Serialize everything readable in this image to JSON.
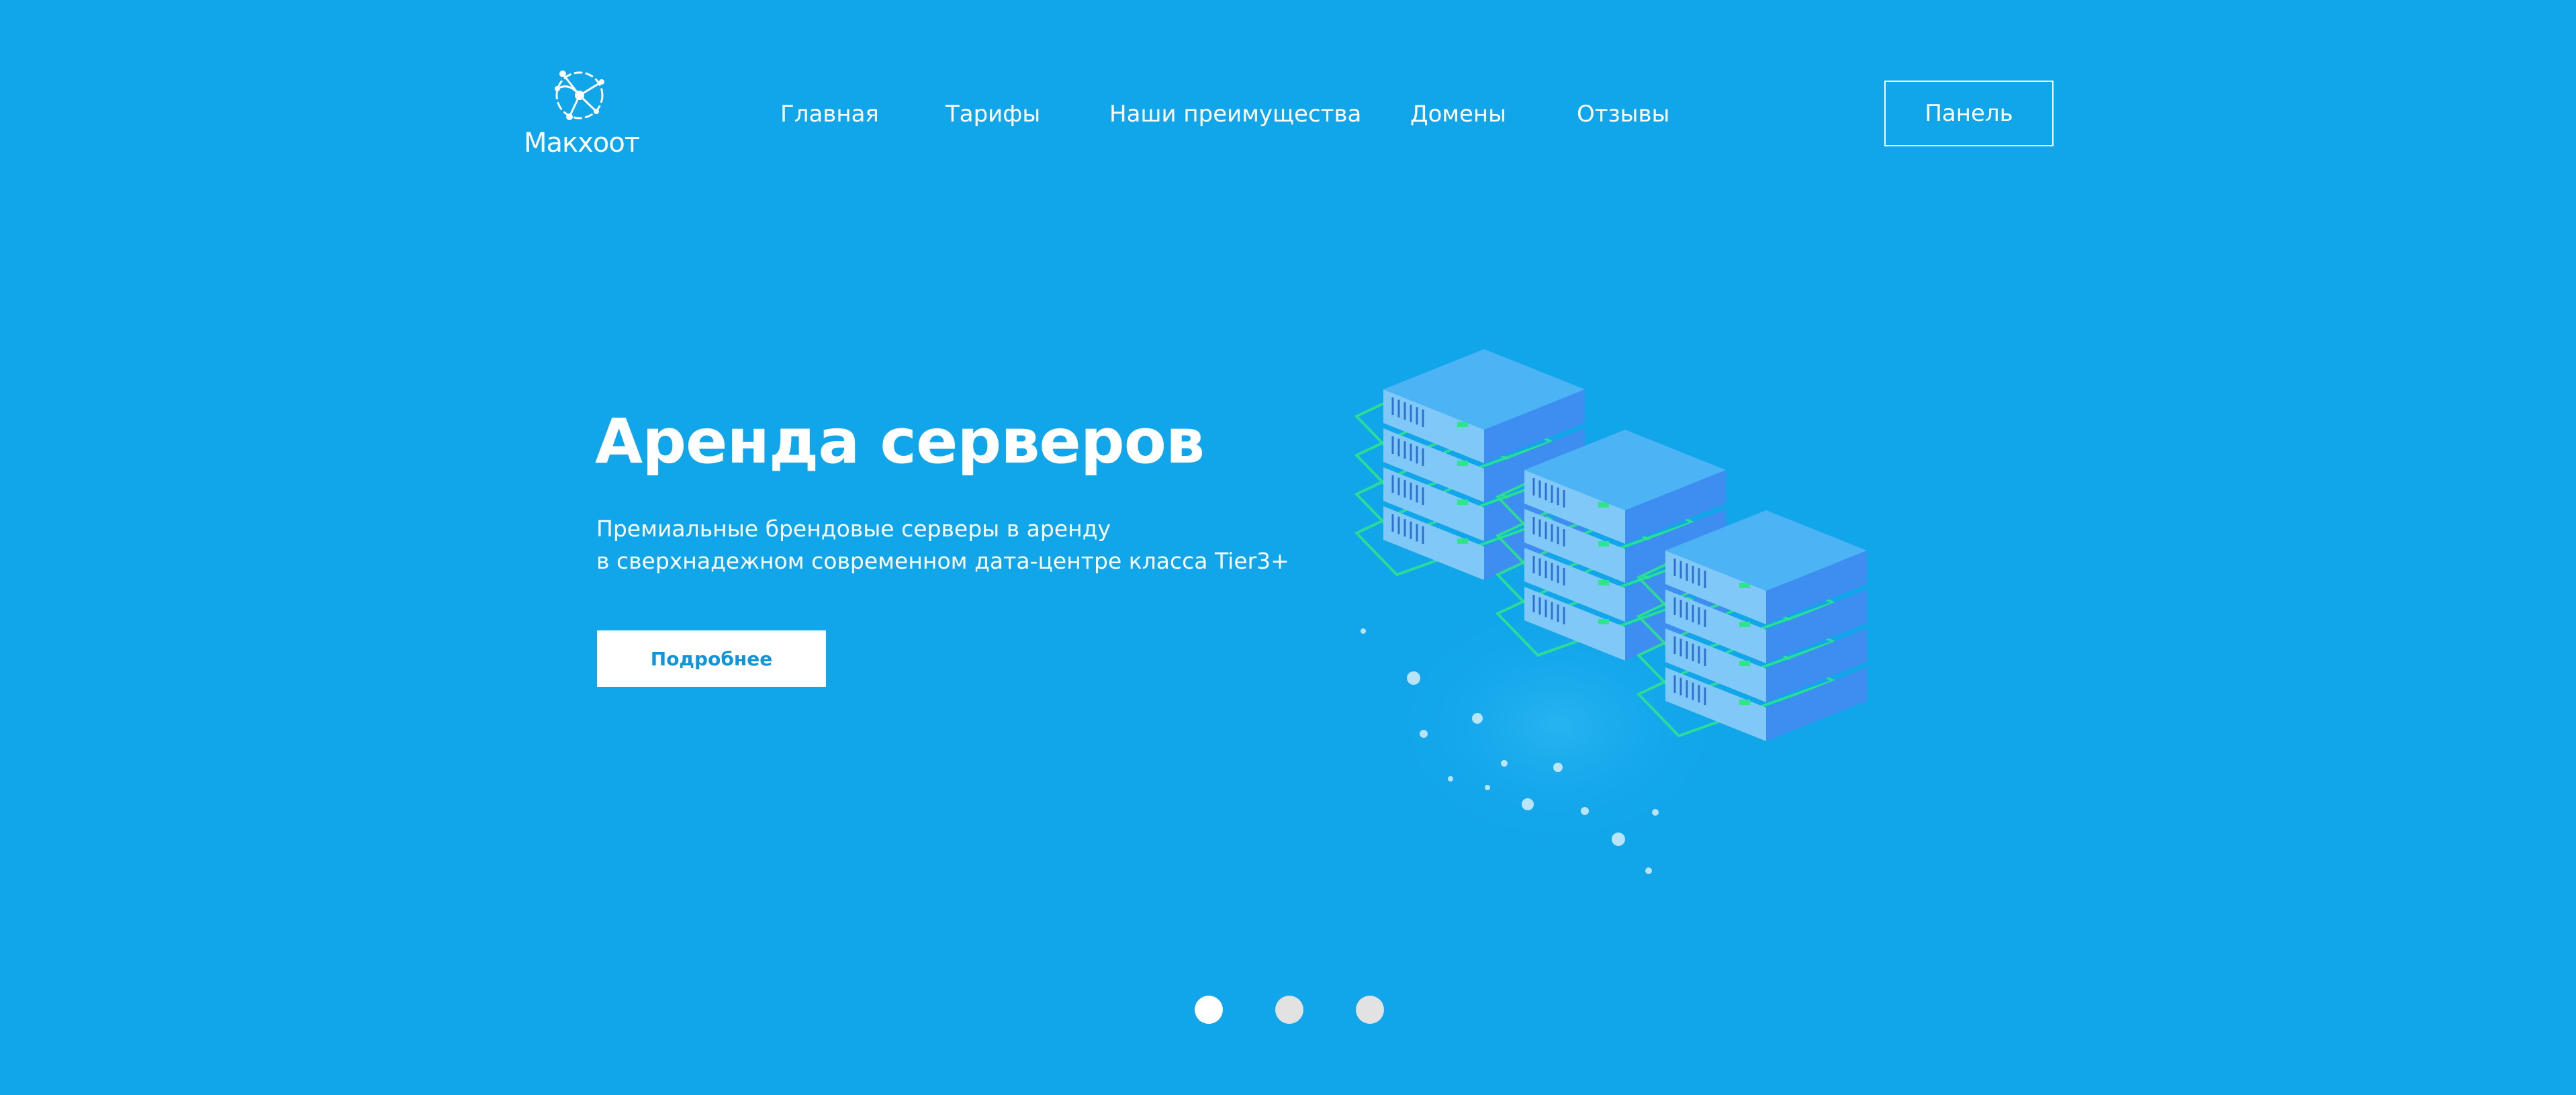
{
  "brand": {
    "name": "Макхоот"
  },
  "nav": {
    "items": [
      {
        "label": "Главная"
      },
      {
        "label": "Тарифы"
      },
      {
        "label": "Наши преимущества"
      },
      {
        "label": "Домены"
      },
      {
        "label": "Отзывы"
      }
    ],
    "panel_label": "Панель"
  },
  "hero": {
    "title": "Аренда серверов",
    "subtitle_line1": "Премиальные брендовые серверы в аренду",
    "subtitle_line2": "в сверхнадежном современном дата-центре класса Tier3+",
    "button_label": "Подробнее",
    "illustration_icon": "server-racks-illustration"
  },
  "slider": {
    "count": 3,
    "active_index": 0
  },
  "colors": {
    "background": "#11a5ea",
    "text": "#ffffff",
    "button_text": "#1294d8",
    "dot_active": "#ffffff",
    "dot_inactive": "#e2e2e2",
    "server_top": "#4cb4f5",
    "server_front": "#7fc8f8",
    "server_side": "#3d8ef0",
    "accent_green": "#2ee58a"
  }
}
